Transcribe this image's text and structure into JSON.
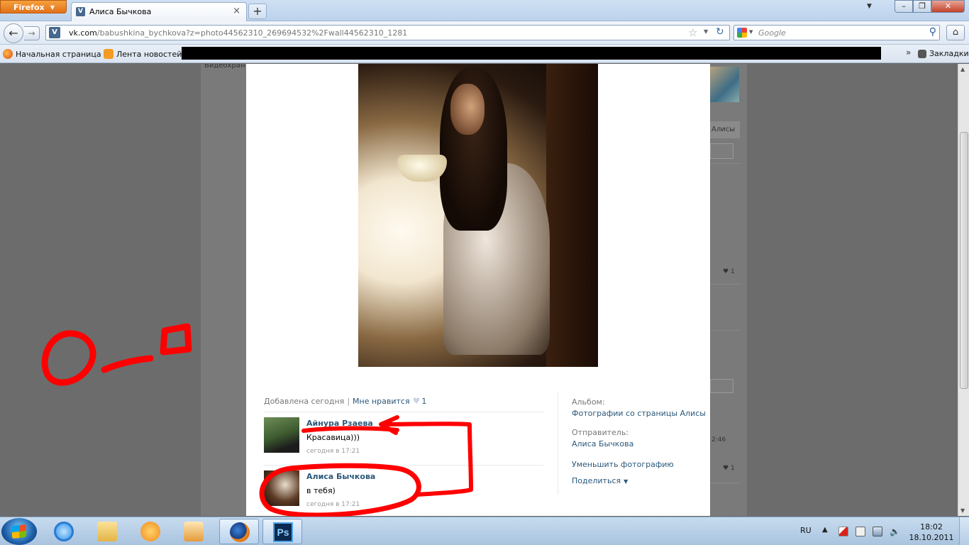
{
  "browser": {
    "menu_button": "Firefox",
    "tab_title": "Алиса Бычкова",
    "url_domain": "vk.com",
    "url_path": "/babushkina_bychkova?z=photo44562310_269694532%2Fwall44562310_1281",
    "search_placeholder": "Google",
    "bookmarks": [
      {
        "label": "Начальная страница"
      },
      {
        "label": "Лента новостей"
      }
    ],
    "bookmarks_menu": "Закладки"
  },
  "background_page": {
    "video_label": "Видеохран",
    "alisy_label": "Алисы",
    "like_count_1": "1",
    "time_fragment": "2:46",
    "like_count_2": "1"
  },
  "photo_view": {
    "added_text": "Добавлена сегодня",
    "like_label": "Мне нравится",
    "like_count": "1",
    "comments": [
      {
        "author": "Айнура Рзаева",
        "text": "Красавица)))",
        "time": "сегодня в 17:21"
      },
      {
        "author": "Алиса Бычкова",
        "text": "в тебя)",
        "time": "сегодня в 17:21"
      }
    ],
    "side": {
      "album_label": "Альбом:",
      "album_link": "Фотографии со страницы Алисы",
      "sender_label": "Отправитель:",
      "sender_link": "Алиса Бычкова",
      "shrink_link": "Уменьшить фотографию",
      "share_link": "Поделиться"
    }
  },
  "taskbar": {
    "lang": "RU",
    "ps_label": "Ps",
    "time": "18:02",
    "date": "18.10.2011"
  },
  "colors": {
    "vk_link": "#2b587a",
    "doodle_red": "#ff0000"
  }
}
